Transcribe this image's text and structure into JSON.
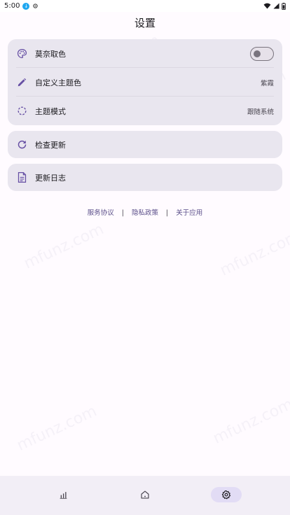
{
  "status_bar": {
    "time": "5:00"
  },
  "header": {
    "title": "设置"
  },
  "settings_group": {
    "items": [
      {
        "label": "莫奈取色",
        "icon": "palette-icon",
        "toggle_on": false
      },
      {
        "label": "自定义主题色",
        "icon": "pencil-icon",
        "value": "紫霞"
      },
      {
        "label": "主题模式",
        "icon": "dashed-circle-icon",
        "value": "跟随系统"
      }
    ]
  },
  "update_card": {
    "label": "检查更新",
    "icon": "refresh-icon"
  },
  "changelog_card": {
    "label": "更新日志",
    "icon": "document-icon"
  },
  "footer_links": {
    "terms": "服务协议",
    "privacy": "隐私政策",
    "about": "关于应用",
    "separator": "|"
  },
  "watermark_text": "mfunz.com",
  "bottom_nav": {
    "items": [
      {
        "icon": "chart-icon",
        "active": false
      },
      {
        "icon": "home-icon",
        "active": false
      },
      {
        "icon": "settings-gear-icon",
        "active": true
      }
    ]
  },
  "colors": {
    "accent": "#6750a4",
    "card_bg": "#e9e6ef",
    "link": "#5b4f8a"
  }
}
